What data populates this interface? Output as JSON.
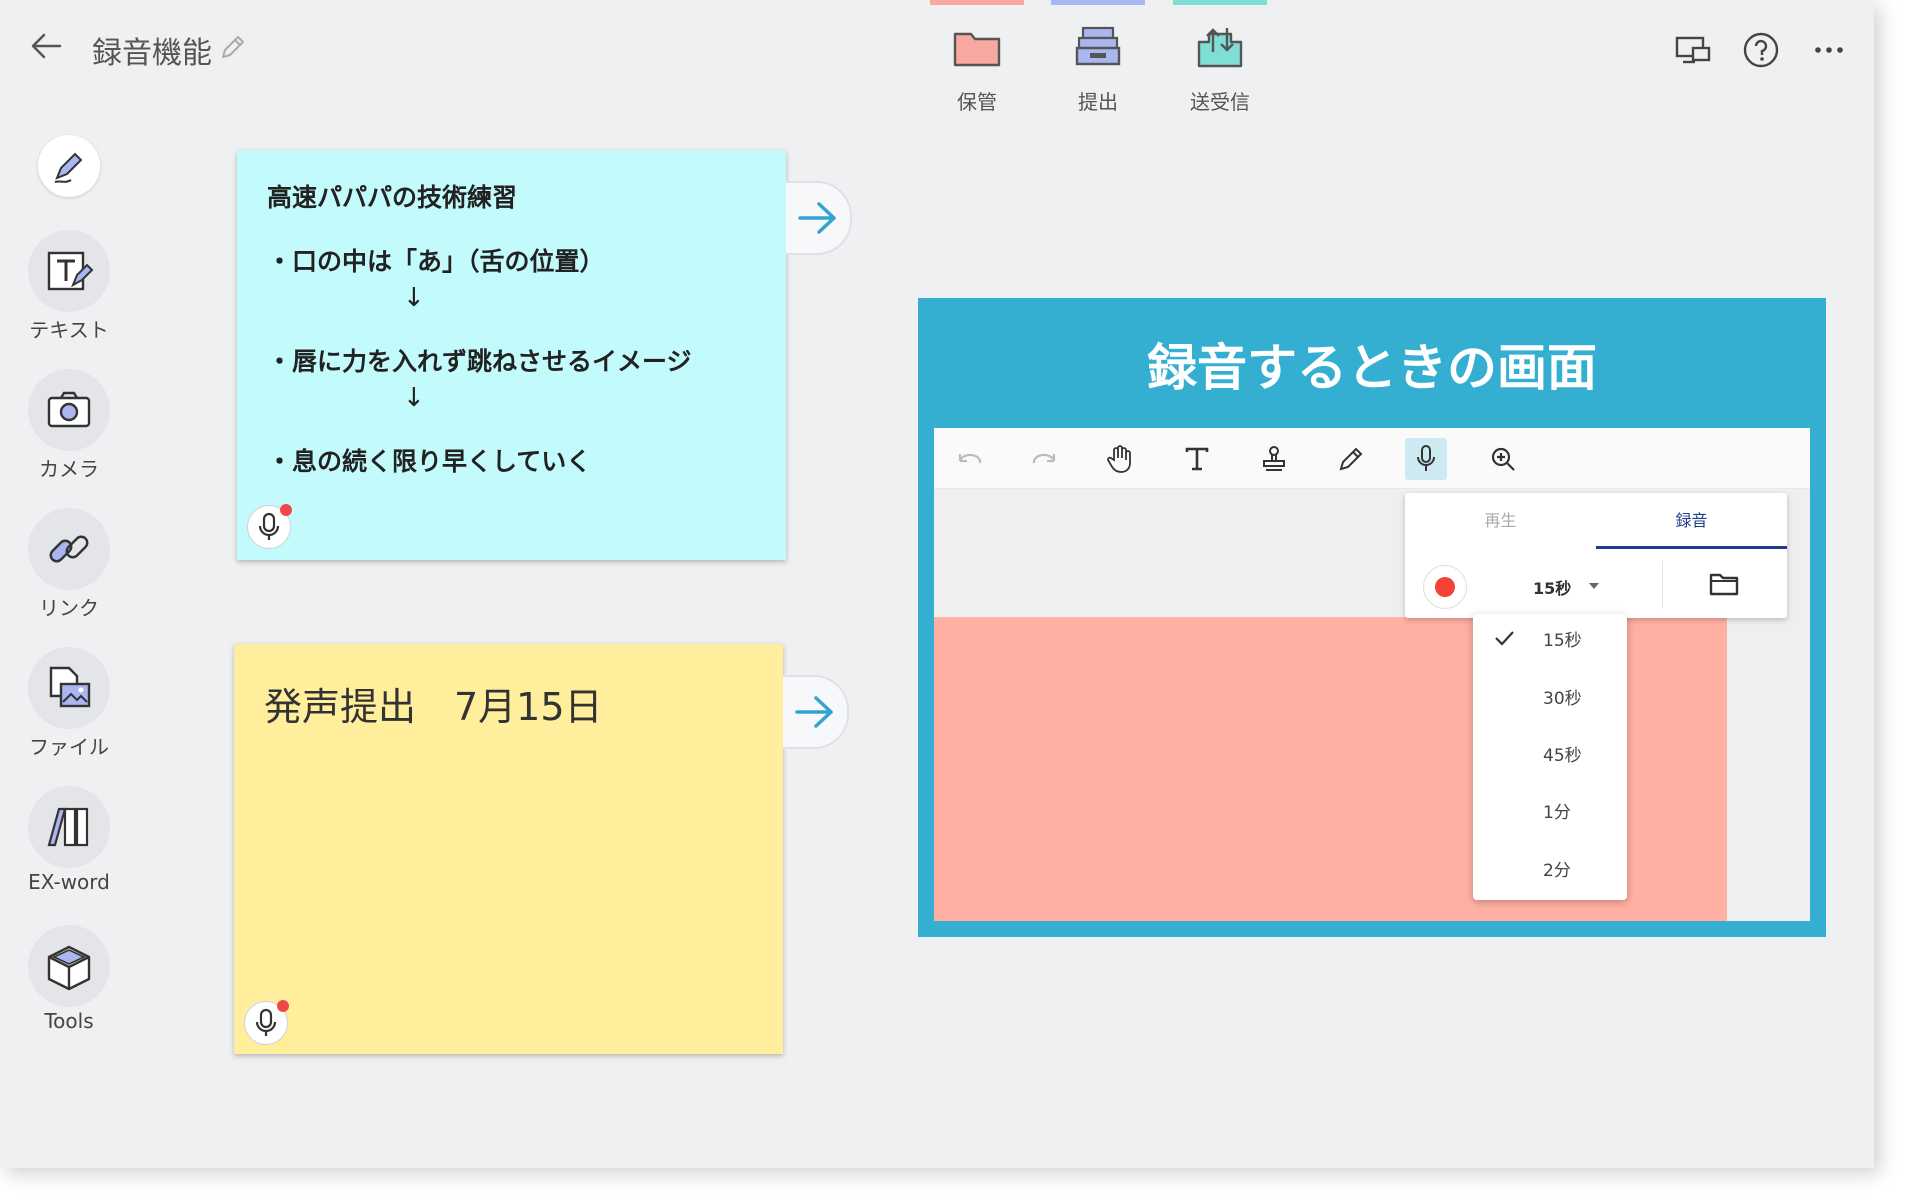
{
  "header": {
    "title": "録音機能",
    "tools": [
      {
        "label": "保管",
        "color": "#f7a8a0",
        "icon": "folder-icon"
      },
      {
        "label": "提出",
        "color": "#a9b6f0",
        "icon": "tray-icon"
      },
      {
        "label": "送受信",
        "color": "#7ee0d5",
        "icon": "send-receive-icon"
      }
    ],
    "right_icons": [
      "screen-share-icon",
      "help-icon",
      "more-icon"
    ]
  },
  "sidebar": {
    "items": [
      {
        "label": "",
        "icon": "pen-icon"
      },
      {
        "label": "テキスト",
        "icon": "text-icon"
      },
      {
        "label": "カメラ",
        "icon": "camera-icon"
      },
      {
        "label": "リンク",
        "icon": "link-icon"
      },
      {
        "label": "ファイル",
        "icon": "file-icon"
      },
      {
        "label": "EX-word",
        "icon": "dictionary-icon"
      },
      {
        "label": "Tools",
        "icon": "toolbox-icon"
      }
    ]
  },
  "cards": {
    "cyan": {
      "title": "高速パパパの技術練習",
      "line1": "・口の中は「あ」（舌の位置）",
      "arrow1": "↓",
      "line2": "・唇に力を入れず跳ねさせるイメージ",
      "arrow2": "↓",
      "line3": "・息の続く限り早くしていく",
      "color": "#c3fbfd"
    },
    "yellow": {
      "text": "発声提出　7月15日",
      "color": "#ffee9b"
    }
  },
  "panel": {
    "title": "録音するときの画面",
    "color": "#34afd2",
    "tabs": {
      "play": "再生",
      "record": "録音"
    },
    "duration": "15秒",
    "options": [
      "15秒",
      "30秒",
      "45秒",
      "1分",
      "2分"
    ],
    "selected_option": "15秒"
  }
}
